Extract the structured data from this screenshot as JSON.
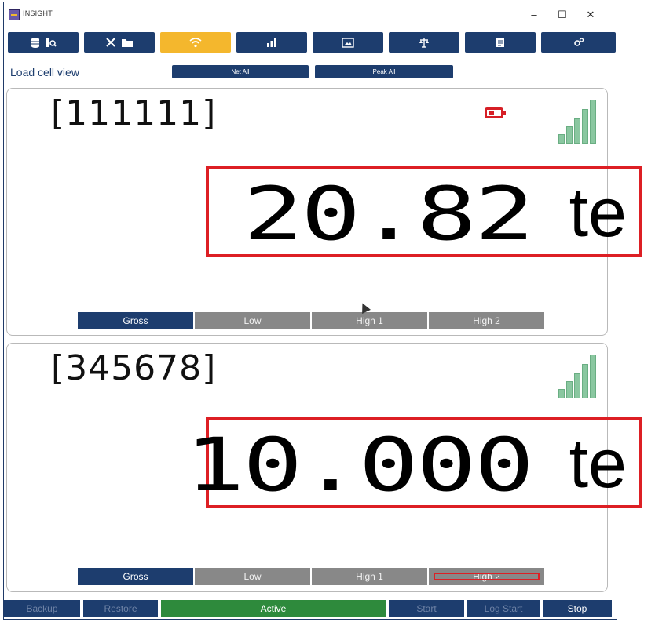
{
  "window": {
    "title": "INSIGHT",
    "controls": {
      "minimize": "–",
      "maximize": "☐",
      "close": "✕"
    }
  },
  "nav": [
    {
      "icons": [
        "database-icon",
        "search-document-icon"
      ],
      "active": false
    },
    {
      "icons": [
        "tools-icon",
        "folder-icon"
      ],
      "active": false
    },
    {
      "icons": [
        "wifi-icon"
      ],
      "active": true
    },
    {
      "icons": [
        "bar-chart-icon"
      ],
      "active": false
    },
    {
      "icons": [
        "image-icon"
      ],
      "active": false
    },
    {
      "icons": [
        "balance-scale-icon"
      ],
      "active": false
    },
    {
      "icons": [
        "document-icon"
      ],
      "active": false
    },
    {
      "icons": [
        "gears-icon"
      ],
      "active": false
    }
  ],
  "subbar": {
    "view_label": "Load cell view",
    "net_all": "Net All",
    "peak_all": "Peak All"
  },
  "cells": [
    {
      "id": "[111111]",
      "value": "20.82",
      "unit": "te",
      "battery_low": true,
      "signal_bars": 5,
      "modes": [
        "Gross",
        "Low",
        "High 1",
        "High 2"
      ],
      "active_mode": "Gross"
    },
    {
      "id": "[345678]",
      "value": "10.000",
      "unit": "te",
      "battery_low": false,
      "signal_bars": 5,
      "modes": [
        "Gross",
        "Low",
        "High 1",
        "High 2"
      ],
      "active_mode": "Gross",
      "highlighted_mode": "High 2"
    }
  ],
  "bottom": {
    "backup": "Backup",
    "restore": "Restore",
    "status": "Active",
    "start": "Start",
    "log_start": "Log Start",
    "stop": "Stop"
  },
  "colors": {
    "navy": "#1d3d6e",
    "accent": "#f4b72d",
    "highlight_red": "#dd1f24",
    "status_green": "#2e8a3c",
    "mode_gray": "#888888",
    "signal_green": "#8ac7a0"
  }
}
